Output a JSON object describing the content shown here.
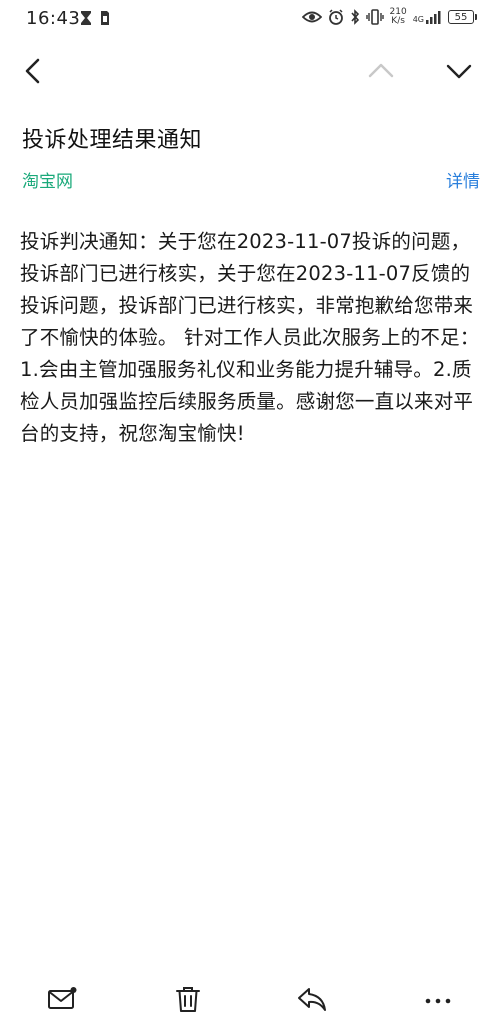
{
  "status_bar": {
    "time": "16:43",
    "net_speed_value": "210",
    "net_speed_unit": "K/s",
    "signal_label": "4G",
    "battery": "55"
  },
  "nav": {
    "back_icon": "chevron-left-icon",
    "prev_icon": "chevron-up-icon",
    "next_icon": "chevron-down-icon"
  },
  "message": {
    "title": "投诉处理结果通知",
    "sender": "淘宝网",
    "details_label": "详情",
    "body": "投诉判决通知：关于您在2023-11-07投诉的问题，投诉部门已进行核实，关于您在2023-11-07反馈的投诉问题，投诉部门已进行核实，非常抱歉给您带来了不愉快的体验。 针对工作人员此次服务上的不足：1.会由主管加强服务礼仪和业务能力提升辅导。2.质检人员加强监控后续服务质量。感谢您一直以来对平台的支持，祝您淘宝愉快!"
  },
  "toolbar": {
    "items": [
      "mail-unread-icon",
      "trash-icon",
      "reply-icon",
      "more-icon"
    ]
  },
  "colors": {
    "sender": "#1aa97a",
    "details": "#2a7fdc",
    "nav_disabled": "#c8c8c8"
  }
}
